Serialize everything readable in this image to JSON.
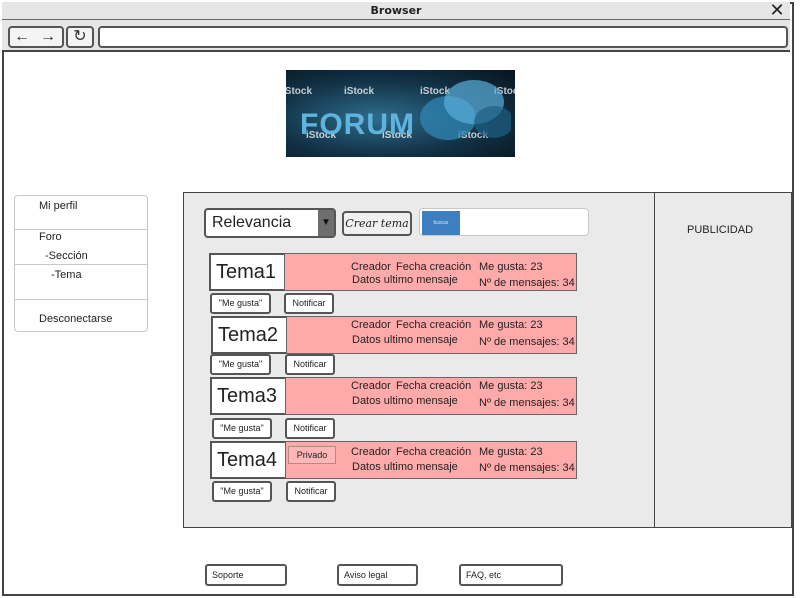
{
  "window": {
    "title": "Browser",
    "close_symbol": "✕"
  },
  "toolbar": {
    "back_symbol": "←",
    "forward_symbol": "→",
    "reload_symbol": "↻",
    "url": ""
  },
  "banner": {
    "text": "FORUM",
    "watermarks": [
      "iStock",
      "iStock",
      "iStock",
      "iStock",
      "iStock",
      "iStock",
      "iStock"
    ]
  },
  "sidebar": {
    "items": [
      {
        "label": "Mi perfil"
      },
      {
        "label": "Foro"
      },
      {
        "label": "-Sección"
      },
      {
        "label": "-Tema"
      },
      {
        "label": "Desconectarse"
      }
    ]
  },
  "filters": {
    "sort_selected": "Relevancia",
    "create_label": "Crear tema",
    "search_button": "buscar",
    "search_value": ""
  },
  "topics": [
    {
      "name": "Tema1",
      "creator": "Creador",
      "date": "Fecha creación",
      "last": "Datos ultimo mensaje",
      "likes": "Me gusta: 23",
      "messages": "Nº de mensajes: 34",
      "private": "",
      "like_button": "\"Me gusta\"",
      "notify_button": "Notificar"
    },
    {
      "name": "Tema2",
      "creator": "Creador",
      "date": "Fecha creación",
      "last": "Datos ultimo mensaje",
      "likes": "Me gusta: 23",
      "messages": "Nº de mensajes: 34",
      "private": "",
      "like_button": "\"Me gusta\"",
      "notify_button": "Notificar"
    },
    {
      "name": "Tema3",
      "creator": "Creador",
      "date": "Fecha creación",
      "last": "Datos ultimo mensaje",
      "likes": "Me gusta: 23",
      "messages": "Nº de mensajes: 34",
      "private": "",
      "like_button": "\"Me gusta\"",
      "notify_button": "Notificar"
    },
    {
      "name": "Tema4",
      "creator": "Creador",
      "date": "Fecha creación",
      "last": "Datos ultimo mensaje",
      "likes": "Me gusta: 23",
      "messages": "Nº de mensajes: 34",
      "private": "Privado",
      "like_button": "\"Me gusta\"",
      "notify_button": "Notificar"
    }
  ],
  "ad": {
    "label": "PUBLICIDAD"
  },
  "footer": {
    "links": [
      "Soporte",
      "Aviso legal",
      "FAQ, etc"
    ]
  },
  "colors": {
    "topic_bar": "#ffaaaa",
    "search_button": "#3d7fc1",
    "panel": "#eaeaea"
  }
}
